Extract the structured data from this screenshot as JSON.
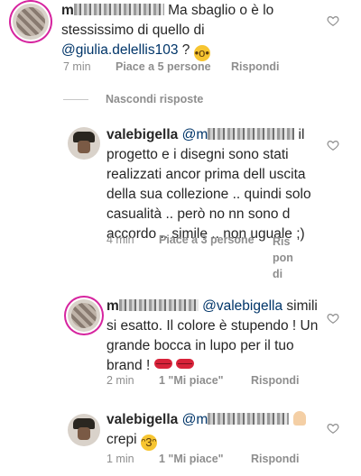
{
  "comments": [
    {
      "username": "m",
      "text_before": "Ma sbaglio o è lo stessissimo di quello di",
      "mention": "@giulia.delellis103",
      "text_after": " ?",
      "emoji": "shocked-face",
      "time": "7 min",
      "likes": "Piace a 5 persone",
      "reply": "Rispondi"
    },
    {
      "username": "valebigella",
      "mention": "@m",
      "text_after": "il progetto e i disegni sono stati realizzati ancor prima dell uscita della sua collezione .. quindi solo casualità .. però no nn sono d accordo .. simile .. non uguale ;)",
      "time": "4 min",
      "likes": "Piace a 3 persone",
      "reply": "Ris pon di"
    },
    {
      "username": "m",
      "mention": "@valebigella",
      "text_after": "simili si esatto. Il colore è stupendo ! Un grande bocca in lupo per il tuo brand !",
      "emoji": "kiss-mark",
      "time": "2 min",
      "likes": "1 \"Mi piace\"",
      "reply": "Rispondi"
    },
    {
      "username": "valebigella",
      "mention": "@m",
      "text_after": "crepi",
      "emoji": "kissing-face",
      "time": "1 min",
      "likes": "1 \"Mi piace\"",
      "reply": "Rispondi"
    }
  ],
  "hide_replies": "Nascondi risposte",
  "colors": {
    "text": "#262626",
    "meta": "#8e8e8e",
    "mention": "#003569",
    "story_ring": "#d6249f"
  }
}
